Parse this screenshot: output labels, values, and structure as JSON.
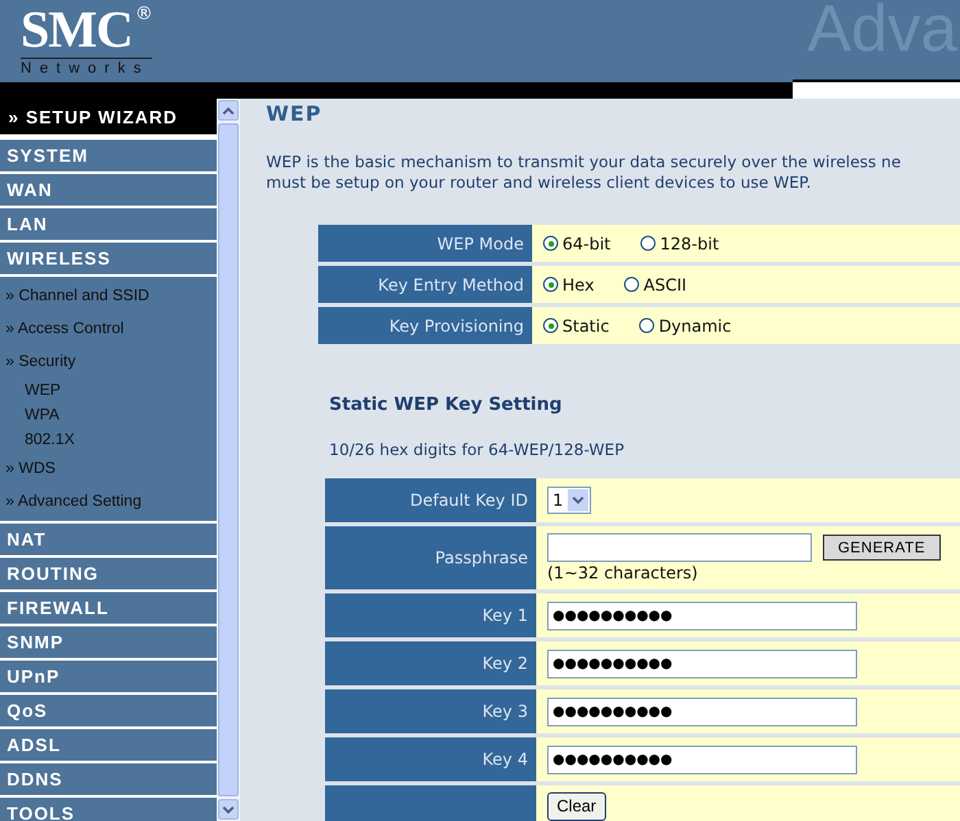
{
  "header": {
    "logo": "SMC",
    "logo_mark": "®",
    "logo_sub": "Networks",
    "banner": "Adva"
  },
  "sidebar": {
    "items": [
      {
        "label": "» SETUP WIZARD",
        "kind": "wizard"
      },
      {
        "label": "SYSTEM",
        "kind": "section"
      },
      {
        "label": "WAN",
        "kind": "section"
      },
      {
        "label": "LAN",
        "kind": "section"
      },
      {
        "label": "WIRELESS",
        "kind": "section"
      },
      {
        "label": "» Channel and SSID",
        "kind": "sub"
      },
      {
        "label": "» Access Control",
        "kind": "sub"
      },
      {
        "label": "» Security",
        "kind": "sub"
      },
      {
        "label": "WEP",
        "kind": "subsub"
      },
      {
        "label": "WPA",
        "kind": "subsub"
      },
      {
        "label": "802.1X",
        "kind": "subsub"
      },
      {
        "label": "» WDS",
        "kind": "sub"
      },
      {
        "label": "» Advanced Setting",
        "kind": "sub"
      },
      {
        "label": "NAT",
        "kind": "section"
      },
      {
        "label": "ROUTING",
        "kind": "section"
      },
      {
        "label": "FIREWALL",
        "kind": "section"
      },
      {
        "label": "SNMP",
        "kind": "section"
      },
      {
        "label": "UPnP",
        "kind": "section"
      },
      {
        "label": "QoS",
        "kind": "section"
      },
      {
        "label": "ADSL",
        "kind": "section"
      },
      {
        "label": "DDNS",
        "kind": "section"
      },
      {
        "label": "TOOLS",
        "kind": "section"
      }
    ]
  },
  "page": {
    "title": "WEP",
    "description": "WEP is the basic mechanism to transmit your data securely over the wireless ne\nmust be setup on your router and wireless client devices to use WEP."
  },
  "mode_table": [
    {
      "label": "WEP Mode",
      "options": [
        {
          "label": "64-bit",
          "selected": true
        },
        {
          "label": "128-bit",
          "selected": false
        }
      ]
    },
    {
      "label": "Key Entry Method",
      "options": [
        {
          "label": "Hex",
          "selected": true
        },
        {
          "label": "ASCII",
          "selected": false
        }
      ]
    },
    {
      "label": "Key Provisioning",
      "options": [
        {
          "label": "Static",
          "selected": true
        },
        {
          "label": "Dynamic",
          "selected": false
        }
      ]
    }
  ],
  "static_section": {
    "title": "Static WEP Key Setting",
    "hint": "10/26 hex digits for 64-WEP/128-WEP"
  },
  "key_table": [
    {
      "kind": "select",
      "label": "Default Key ID",
      "value": "1"
    },
    {
      "kind": "passphrase",
      "label": "Passphrase",
      "button": "GENERATE",
      "note": "(1~32 characters)"
    },
    {
      "kind": "key",
      "label": "Key 1",
      "value": "●●●●●●●●●●"
    },
    {
      "kind": "key",
      "label": "Key 2",
      "value": "●●●●●●●●●●"
    },
    {
      "kind": "key",
      "label": "Key 3",
      "value": "●●●●●●●●●●"
    },
    {
      "kind": "key",
      "label": "Key 4",
      "value": "●●●●●●●●●●"
    },
    {
      "kind": "button",
      "button": "Clear"
    }
  ]
}
